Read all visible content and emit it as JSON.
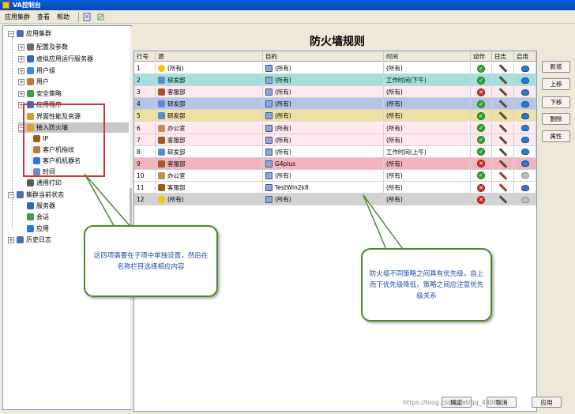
{
  "window": {
    "title": "VA控制台"
  },
  "menu": [
    "应用集群",
    "查看",
    "帮助"
  ],
  "tree": {
    "items": [
      {
        "label": "应用集群",
        "level": 0,
        "expander": "−",
        "icon_color": "#4a6fb0"
      },
      {
        "label": "配置及参数",
        "level": 1,
        "expander": "+",
        "icon_color": "#6a6a6a"
      },
      {
        "label": "虚拟应用运行服务器",
        "level": 1,
        "expander": "+",
        "icon_color": "#2a6ab8"
      },
      {
        "label": "用户组",
        "level": 1,
        "expander": "+",
        "icon_color": "#3a8ad0"
      },
      {
        "label": "用户",
        "level": 1,
        "expander": "+",
        "icon_color": "#c07a30"
      },
      {
        "label": "安全策略",
        "level": 1,
        "expander": "+",
        "icon_color": "#3aa04a"
      },
      {
        "label": "应用程序",
        "level": 1,
        "expander": "+",
        "icon_color": "#2a78d8"
      },
      {
        "label": "界面性能及资源",
        "level": 1,
        "expander": "",
        "icon_color": "#d0a030"
      },
      {
        "label": "接入防火墙",
        "level": 1,
        "expander": "−",
        "icon_color": "#e0a020"
      },
      {
        "label": "IP",
        "level": 2,
        "expander": "",
        "icon_color": "#a05a20"
      },
      {
        "label": "客户机指纹",
        "level": 2,
        "expander": "",
        "icon_color": "#c07a30"
      },
      {
        "label": "客户机机器名",
        "level": 2,
        "expander": "",
        "icon_color": "#2a78d8"
      },
      {
        "label": "时间",
        "level": 2,
        "expander": "",
        "icon_color": "#6a8ac0"
      },
      {
        "label": "通用打印",
        "level": 1,
        "expander": "",
        "icon_color": "#5a5a5a"
      },
      {
        "label": "集群当前状态",
        "level": 0,
        "expander": "−",
        "icon_color": "#4a6fb0"
      },
      {
        "label": "服务器",
        "level": 1,
        "expander": "",
        "icon_color": "#2a6ab8"
      },
      {
        "label": "会话",
        "level": 1,
        "expander": "",
        "icon_color": "#3aa04a"
      },
      {
        "label": "应用",
        "level": 1,
        "expander": "",
        "icon_color": "#2a78d8"
      },
      {
        "label": "历史日志",
        "level": 0,
        "expander": "+",
        "icon_color": "#4a6fb0"
      }
    ]
  },
  "main": {
    "title": "防火墙规则",
    "columns": [
      "行号",
      "源",
      "目的",
      "时间",
      "动作",
      "日志",
      "启用"
    ],
    "rows": [
      {
        "num": "1",
        "src": "(所有)",
        "dst": "(所有)",
        "time": "(所有)",
        "action": "allow",
        "log": "on",
        "enabled": true,
        "bg": "#ffffff"
      },
      {
        "num": "2",
        "src": "研发部",
        "dst": "(所有)",
        "time": "工作时间(下午)",
        "action": "allow",
        "log": "on",
        "enabled": true,
        "bg": "#a6dede"
      },
      {
        "num": "3",
        "src": "客服部",
        "dst": "(所有)",
        "time": "(所有)",
        "action": "deny",
        "log": "on",
        "enabled": true,
        "bg": "#ffe8ee"
      },
      {
        "num": "4",
        "src": "研发部",
        "dst": "(所有)",
        "time": "(所有)",
        "action": "allow",
        "log": "on",
        "enabled": true,
        "bg": "#b4c4e4"
      },
      {
        "num": "5",
        "src": "研发部",
        "dst": "(所有)",
        "time": "(所有)",
        "action": "allow",
        "log": "on",
        "enabled": true,
        "bg": "#f0e0a4"
      },
      {
        "num": "6",
        "src": "办公室",
        "dst": "(所有)",
        "time": "(所有)",
        "action": "allow",
        "log": "on",
        "enabled": true,
        "bg": "#ffe8ee"
      },
      {
        "num": "7",
        "src": "客服部",
        "dst": "(所有)",
        "time": "(所有)",
        "action": "allow",
        "log": "on",
        "enabled": true,
        "bg": "#ffe8ee"
      },
      {
        "num": "8",
        "src": "研发部",
        "dst": "(所有)",
        "time": "工作时间(上午)",
        "action": "allow",
        "log": "on",
        "enabled": true,
        "bg": "#ffffff"
      },
      {
        "num": "9",
        "src": "客服部",
        "dst": "G4plus",
        "time": "(所有)",
        "action": "deny",
        "log": "on",
        "enabled": true,
        "bg": "#f4b4be"
      },
      {
        "num": "10",
        "src": "办公室",
        "dst": "(所有)",
        "time": "(所有)",
        "action": "allow",
        "log": "off",
        "enabled": false,
        "bg": "#ffffff"
      },
      {
        "num": "11",
        "src": "客服部",
        "dst": "TestWin2k8",
        "time": "(所有)",
        "action": "deny",
        "log": "off",
        "enabled": true,
        "bg": "#ffffff"
      },
      {
        "num": "12",
        "src": "(所有)",
        "dst": "(所有)",
        "time": "(所有)",
        "action": "deny",
        "log": "on",
        "enabled": false,
        "bg": "#d2d2d2"
      }
    ],
    "side_buttons": [
      "新增",
      "上移",
      "下移",
      "删除",
      "属性"
    ],
    "bottom_buttons": [
      "确定",
      "取消",
      "应用"
    ]
  },
  "callouts": {
    "left": "这四项需要在子项中单独设置，然后在名称栏目选择相应内容",
    "right": "防火墙不同策略之间具有优先级，自上而下优先级降低，策略之间应注意优先级关系"
  },
  "watermark": "https://blog.csdn.net/qq_44080"
}
